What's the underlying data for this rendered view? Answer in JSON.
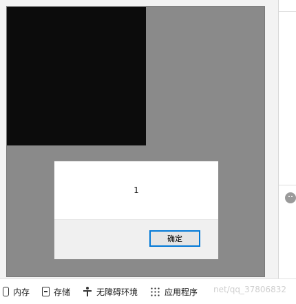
{
  "dialog": {
    "message": "1",
    "ok_label": "确定"
  },
  "toolbar": {
    "items": [
      {
        "label": "内存",
        "icon": "memory-icon"
      },
      {
        "label": "存储",
        "icon": "storage-icon"
      },
      {
        "label": "无障碍环境",
        "icon": "accessibility-icon"
      },
      {
        "label": "应用程序",
        "icon": "apps-icon"
      }
    ]
  },
  "watermark": "net/qq_37806832",
  "colors": {
    "viewport_bg": "#8a8a8a",
    "black_box": "#0c0c0c",
    "button_border": "#0078d7"
  }
}
